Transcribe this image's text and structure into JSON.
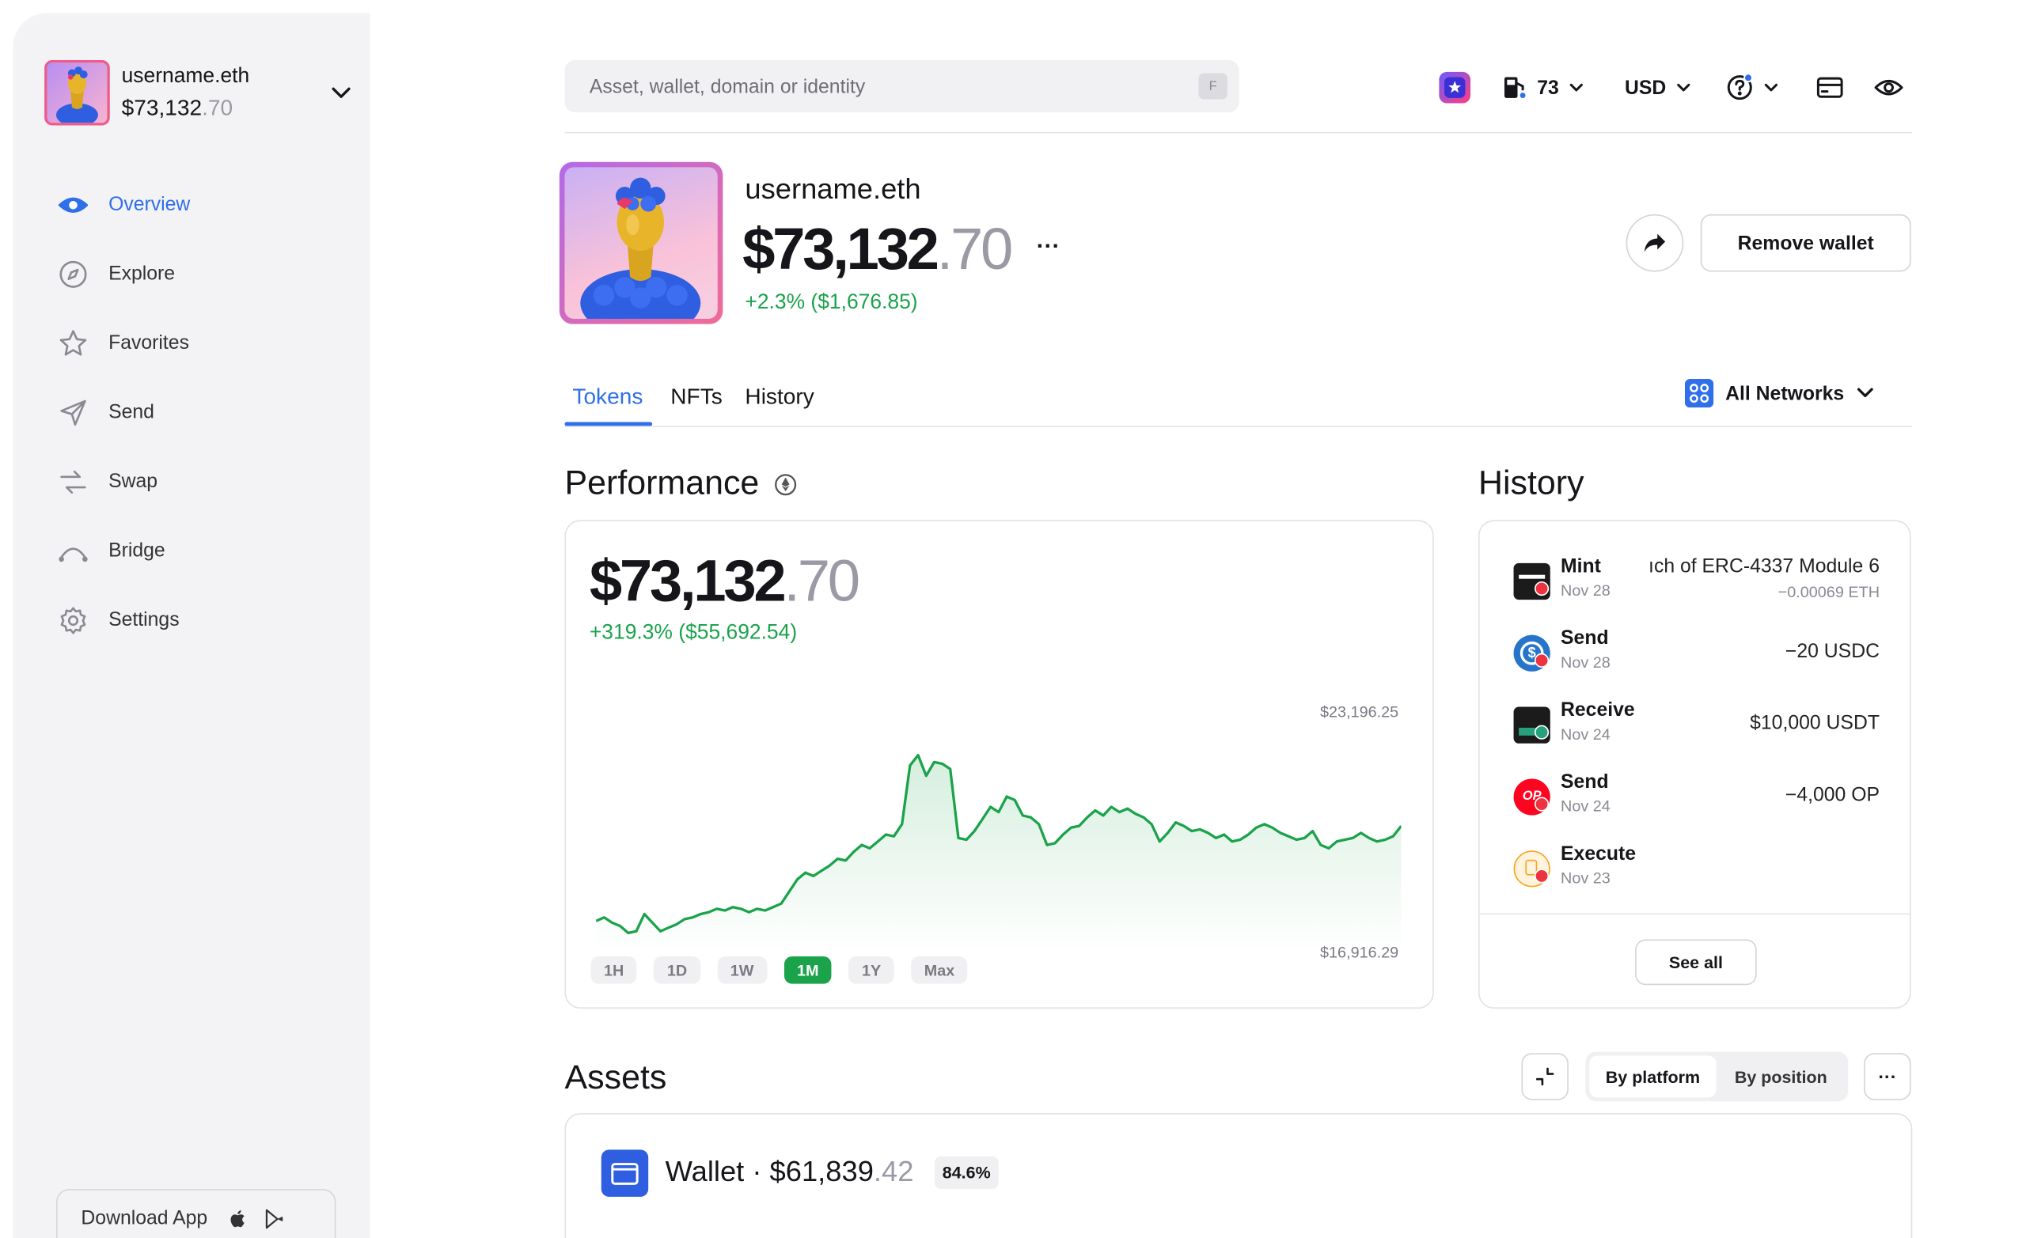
{
  "sidebar": {
    "account": {
      "name": "username.eth",
      "balance_main": "$73,132",
      "balance_cents": ".70"
    },
    "nav": [
      {
        "label": "Overview",
        "icon": "eye-icon",
        "active": true
      },
      {
        "label": "Explore",
        "icon": "compass-icon"
      },
      {
        "label": "Favorites",
        "icon": "star-icon"
      },
      {
        "label": "Send",
        "icon": "send-icon"
      },
      {
        "label": "Swap",
        "icon": "swap-icon"
      },
      {
        "label": "Bridge",
        "icon": "bridge-icon"
      },
      {
        "label": "Settings",
        "icon": "gear-icon"
      }
    ],
    "download_label": "Download App"
  },
  "topbar": {
    "search_placeholder": "Asset, wallet, domain or identity",
    "search_shortcut": "F",
    "gas_value": "73",
    "currency": "USD"
  },
  "profile": {
    "name": "username.eth",
    "balance_main": "$73,132",
    "balance_cents": ".70",
    "more": "···",
    "change": "+2.3% ($1,676.85)",
    "remove_label": "Remove wallet"
  },
  "tabs": [
    {
      "label": "Tokens",
      "active": true
    },
    {
      "label": "NFTs"
    },
    {
      "label": "History"
    }
  ],
  "networks_label": "All Networks",
  "performance": {
    "title": "Performance",
    "balance_main": "$73,132",
    "balance_cents": ".70",
    "change": "+319.3% ($55,692.54)",
    "high_label": "$23,196.25",
    "low_label": "$16,916.29",
    "ranges": [
      "1H",
      "1D",
      "1W",
      "1M",
      "1Y",
      "Max"
    ],
    "active_range": "1M",
    "accent_color": "#1aa34a",
    "chart_data": {
      "type": "area",
      "title": "",
      "xlabel": "",
      "ylabel": "",
      "ylim": [
        16916.29,
        23196.25
      ],
      "grid": false,
      "x": [
        0,
        1,
        2,
        3,
        4,
        5,
        6,
        7,
        8,
        9,
        10,
        11,
        12,
        13,
        14,
        15,
        16,
        17,
        18,
        19,
        20,
        21,
        22,
        23,
        24,
        25,
        26,
        27,
        28,
        29,
        30,
        31,
        32,
        33,
        34,
        35,
        36,
        37,
        38,
        39,
        40,
        41,
        42,
        43,
        44,
        45,
        46,
        47,
        48,
        49,
        50,
        51,
        52,
        53,
        54,
        55,
        56,
        57,
        58,
        59,
        60,
        61,
        62,
        63,
        64,
        65,
        66,
        67,
        68,
        69,
        70,
        71,
        72,
        73,
        74,
        75,
        76,
        77,
        78,
        79,
        80,
        81,
        82,
        83,
        84,
        85,
        86,
        87,
        88,
        89,
        90,
        91,
        92,
        93,
        94,
        95,
        96,
        97,
        98,
        99,
        100
      ],
      "series": [
        {
          "values": [
            17300,
            17400,
            17250,
            17150,
            16950,
            17000,
            17500,
            17250,
            17000,
            17100,
            17200,
            17350,
            17400,
            17500,
            17550,
            17650,
            17600,
            17700,
            17650,
            17550,
            17650,
            17600,
            17700,
            17800,
            18150,
            18500,
            18700,
            18600,
            18750,
            18900,
            19100,
            19050,
            19300,
            19500,
            19400,
            19600,
            19800,
            19750,
            20100,
            21800,
            22100,
            21500,
            21900,
            21850,
            21700,
            19700,
            19650,
            19900,
            20250,
            20600,
            20450,
            20900,
            20800,
            20350,
            20300,
            20100,
            19500,
            19550,
            19800,
            20000,
            20050,
            20300,
            20500,
            20350,
            20600,
            20450,
            20550,
            20400,
            20300,
            20100,
            19600,
            19850,
            20150,
            20050,
            19900,
            19950,
            19850,
            19700,
            19800,
            19600,
            19650,
            19800,
            20000,
            20100,
            20000,
            19850,
            19750,
            19650,
            19700,
            19900,
            19500,
            19400,
            19600,
            19650,
            19700,
            19850,
            19700,
            19600,
            19650,
            19750,
            20050
          ]
        }
      ]
    }
  },
  "history": {
    "title": "History",
    "items": [
      {
        "type": "Mint",
        "date": "Nov 28",
        "amount": "ıch of ERC-4337 Module 6",
        "sub": "−0.00069 ETH",
        "icon": "card-nft-icon",
        "color": "#1b1b1b"
      },
      {
        "type": "Send",
        "date": "Nov 28",
        "amount": "−20 USDC",
        "icon": "usdc-icon",
        "color": "#2775ca"
      },
      {
        "type": "Receive",
        "date": "Nov 24",
        "amount": "$10,000 USDT",
        "icon": "usdt-card-icon",
        "color": "#1b1b1b"
      },
      {
        "type": "Send",
        "date": "Nov 24",
        "amount": "−4,000 OP",
        "icon": "op-icon",
        "color": "#ff0420"
      },
      {
        "type": "Execute",
        "date": "Nov 23",
        "amount": "",
        "icon": "document-icon",
        "color": "#f5a623"
      }
    ],
    "see_all": "See all"
  },
  "assets": {
    "title": "Assets",
    "view_by_platform": "By platform",
    "view_by_position": "By position",
    "more": "···",
    "wallet_label": "Wallet · $61,839",
    "wallet_cents": ".42",
    "wallet_pct": "84.6%"
  }
}
